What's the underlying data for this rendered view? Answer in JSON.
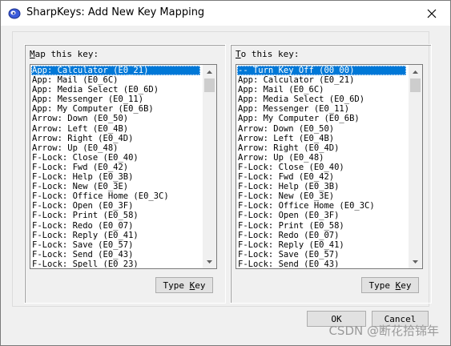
{
  "window": {
    "title": "SharpKeys: Add New Key Mapping",
    "close_symbol": "✕"
  },
  "left_panel": {
    "label_prefix": "M",
    "label_rest": "ap this key:",
    "items": [
      "App: Calculator (E0_21)",
      "App: Mail (E0_6C)",
      "App: Media Select (E0_6D)",
      "App: Messenger (E0_11)",
      "App: My Computer (E0_6B)",
      "Arrow: Down (E0_50)",
      "Arrow: Left (E0_4B)",
      "Arrow: Right (E0_4D)",
      "Arrow: Up (E0_48)",
      "F-Lock: Close (E0_40)",
      "F-Lock: Fwd (E0_42)",
      "F-Lock: Help (E0_3B)",
      "F-Lock: New (E0_3E)",
      "F-Lock: Office Home (E0_3C)",
      "F-Lock: Open (E0_3F)",
      "F-Lock: Print (E0_58)",
      "F-Lock: Redo (E0_07)",
      "F-Lock: Reply (E0_41)",
      "F-Lock: Save (E0_57)",
      "F-Lock: Send (E0_43)",
      "F-Lock: Spell (E0_23)"
    ],
    "selected_index": 0,
    "type_key_button_prefix": "Type ",
    "type_key_button_underlined": "K",
    "type_key_button_rest": "ey"
  },
  "right_panel": {
    "label_prefix": "T",
    "label_rest": "o this key:",
    "items": [
      "-- Turn Key Off (00_00)",
      "App: Calculator (E0_21)",
      "App: Mail (E0_6C)",
      "App: Media Select (E0_6D)",
      "App: Messenger (E0_11)",
      "App: My Computer (E0_6B)",
      "Arrow: Down (E0_50)",
      "Arrow: Left (E0_4B)",
      "Arrow: Right (E0_4D)",
      "Arrow: Up (E0_48)",
      "F-Lock: Close (E0_40)",
      "F-Lock: Fwd (E0_42)",
      "F-Lock: Help (E0_3B)",
      "F-Lock: New (E0_3E)",
      "F-Lock: Office Home (E0_3C)",
      "F-Lock: Open (E0_3F)",
      "F-Lock: Print (E0_58)",
      "F-Lock: Redo (E0_07)",
      "F-Lock: Reply (E0_41)",
      "F-Lock: Save (E0_57)",
      "F-Lock: Send (E0_43)"
    ],
    "selected_index": 0,
    "type_key_button_prefix": "Type ",
    "type_key_button_underlined": "K",
    "type_key_button_rest": "ey"
  },
  "buttons": {
    "ok": "OK",
    "cancel": "Cancel"
  },
  "watermark": "CSDN @断花拾锦年",
  "colors": {
    "selection": "#0078d7",
    "window_bg": "#f0f0f0",
    "button_bg": "#e1e1e1"
  },
  "icons": {
    "app": "sharpkeys-app-icon",
    "close": "close-icon",
    "scroll_up": "scroll-up-arrow-icon",
    "scroll_down": "scroll-down-arrow-icon"
  }
}
